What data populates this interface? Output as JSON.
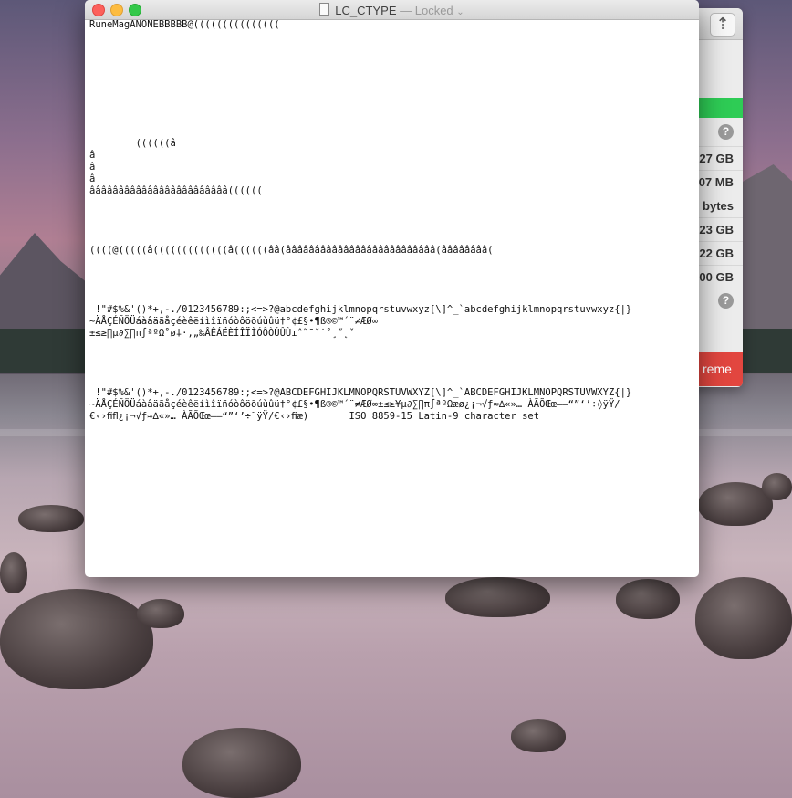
{
  "window": {
    "title": "LC_CTYPE",
    "status": "— Locked",
    "lines": [
      "RuneMagANONEBBBBB@(((((((((((((((",
      "",
      "",
      "",
      "",
      "",
      "",
      "",
      "",
      "",
      "        ((((((â",
      "â",
      "â",
      "â",
      "ââââââââââââââââââââââââ((((((",
      "",
      "",
      "",
      "",
      "((((@(((((â(((((((((((((â((((((ââ(ââââââââââââââââââââââââââ(ââââââââ(",
      "",
      "",
      "",
      "",
      " !\"#$%&'()*+,-./0123456789:;<=>?@abcdefghijklmnopqrstuvwxyz[\\]^_`abcdefghijklmnopqrstuvwxyz{|}",
      "~ÄÅÇÉÑÖÜáàâäãåçéèêëíìîïñóòôöõúùûü†°¢£§•¶ß®©™´¨≠ÆØ∞",
      "±≤≥∏µ∂∑∏π∫ªºΩ˚ø‡·‚„‰ÂÊÁËÈÍÎÏÌÓÔÒÚÛÙıˆ˜¯˘˙˚¸˝˛ˇ",
      "",
      "",
      "",
      "",
      " !\"#$%&'()*+,-./0123456789:;<=>?@ABCDEFGHIJKLMNOPQRSTUVWXYZ[\\]^_`ABCDEFGHIJKLMNOPQRSTUVWXYZ{|}",
      "~ÄÅÇÉÑÖÜáàâäãåçéèêëíìîïñóòôöõúùûü†°¢£§•¶ß®©™´¨≠ÆØ∞±≤≥¥µ∂∑∏π∫ªºΩæø¿¡¬√ƒ≈∆«»… ÀÃÕŒœ–—“”‘’÷◊ÿŸ/",
      "€‹›ﬁﬂ¿¡¬√ƒ≈∆«»… ÀÃÕŒœ–—“”‘’÷¨ÿŸ/€‹›ﬁæ)       ISO 8859-15 Latin-9 character set"
    ]
  },
  "back_window": {
    "values": [
      "27 GB",
      "07 MB",
      "bytes",
      "23 GB",
      "22 GB",
      "00 GB"
    ],
    "button_label": "reme"
  },
  "icons": {
    "share": "⇡",
    "help": "?"
  }
}
